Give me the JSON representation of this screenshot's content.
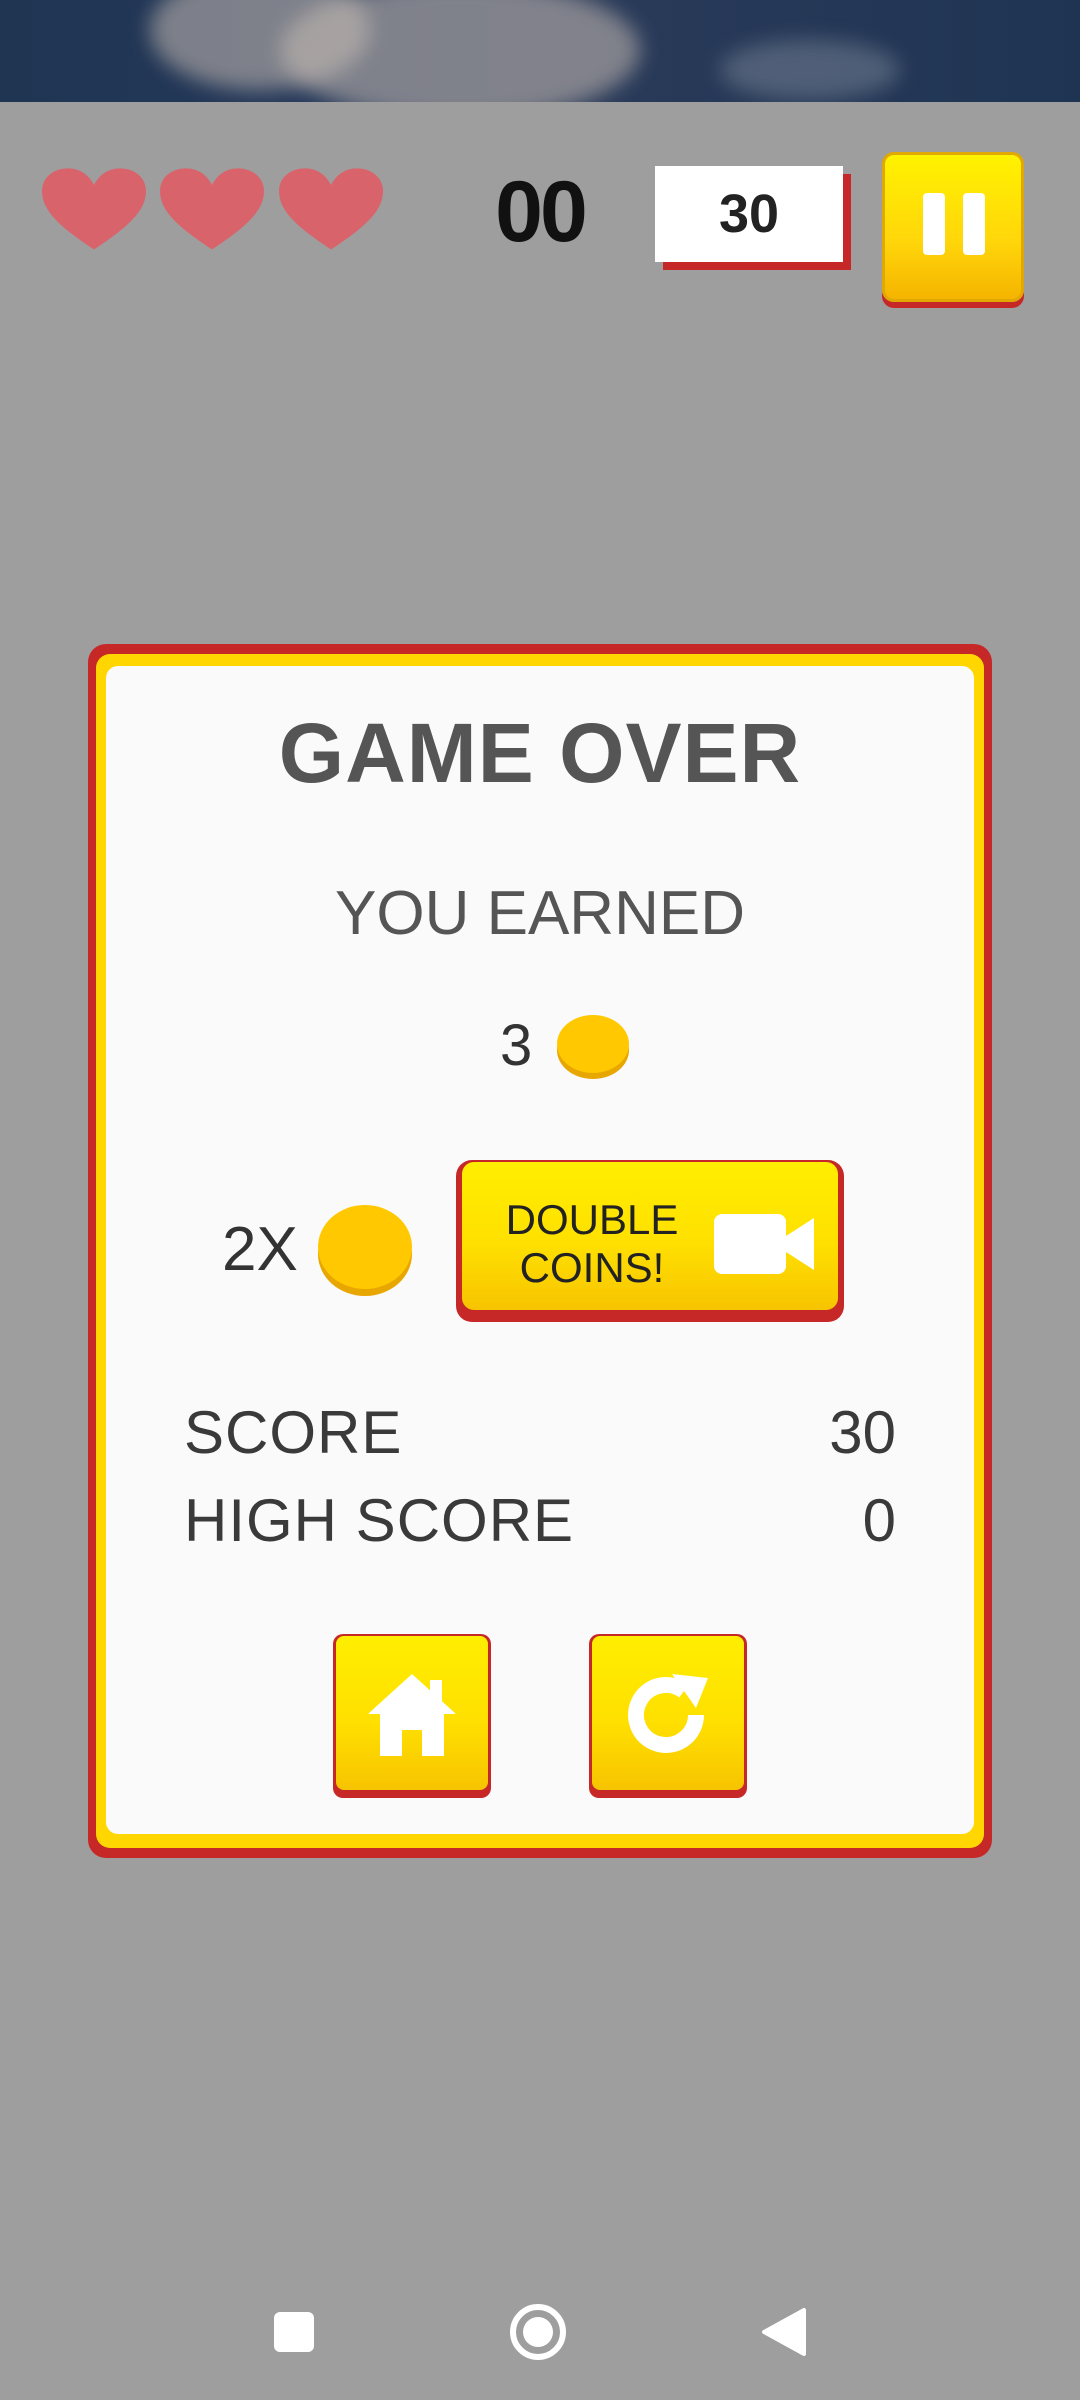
{
  "hud": {
    "lives": 3,
    "counter": "00",
    "score": "30"
  },
  "dialog": {
    "title": "GAME OVER",
    "earned_label": "YOU EARNED",
    "earned_amount": "3",
    "multiplier_label": "2X",
    "double_button": {
      "line1": "DOUBLE",
      "line2": "COINS!"
    },
    "stats": {
      "score_label": "SCORE",
      "score_value": "30",
      "high_score_label": "HIGH SCORE",
      "high_score_value": "0"
    },
    "buttons": {
      "home_icon": "home-icon",
      "restart_icon": "restart-icon"
    }
  },
  "colors": {
    "heart": "#d9636b",
    "accent_yellow": "#ffe000",
    "accent_red": "#c62828",
    "overlay_gray": "#9e9e9e",
    "coin": "#ffc800"
  },
  "nav": {
    "recents_icon": "square-icon",
    "home_icon": "circle-icon",
    "back_icon": "triangle-back-icon"
  }
}
